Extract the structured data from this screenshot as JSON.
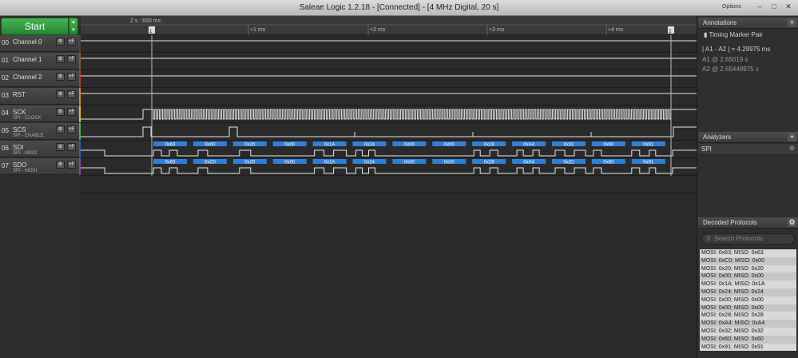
{
  "window": {
    "title": "Saleae Logic 1.2.18 - [Connected] - [4 MHz Digital, 20 s]",
    "options_label": "Options",
    "minimize_icon": "–",
    "maximize_icon": "□",
    "close_icon": "✕"
  },
  "controls": {
    "start_label": "Start",
    "arrow_up": "▲",
    "arrow_down": "▼"
  },
  "ruler": {
    "position_label": "2 s : 650 ms",
    "ticks": [
      "+1 ms",
      "+2 ms",
      "+3 ms",
      "+4 ms"
    ]
  },
  "channels": [
    {
      "num": "00",
      "name": "Channel 0",
      "sub": "",
      "color": "#444444"
    },
    {
      "num": "01",
      "name": "Channel 1",
      "sub": "",
      "color": "#8b5a2b"
    },
    {
      "num": "02",
      "name": "Channel 2",
      "sub": "",
      "color": "#c0392b"
    },
    {
      "num": "03",
      "name": "RST",
      "sub": "",
      "color": "#e08a1a"
    },
    {
      "num": "04",
      "name": "SCK",
      "sub": "SPI - CLOCK",
      "color": "#e8c11a"
    },
    {
      "num": "05",
      "name": "SCS",
      "sub": "SPI - ENABLE",
      "color": "#4caf50"
    },
    {
      "num": "06",
      "name": "SDI",
      "sub": "SPI - MISO",
      "color": "#2f5fc4"
    },
    {
      "num": "07",
      "name": "SDO",
      "sub": "SPI - MOSI",
      "color": "#8e44ad"
    }
  ],
  "channel_buttons": {
    "gear": "⚙",
    "flag": "+F"
  },
  "protocol_bytes": {
    "miso": [
      "0x63",
      "0x00",
      "0x20",
      "0x00",
      "0x1A",
      "0x24",
      "0x00",
      "0x00",
      "0x28",
      "0xA4",
      "0x32",
      "0x60",
      "0x91"
    ],
    "mosi": [
      "0x63",
      "0xC0",
      "0x20",
      "0x00",
      "0x1A",
      "0x24",
      "0x00",
      "0x00",
      "0x28",
      "0xA4",
      "0x32",
      "0x60",
      "0x91"
    ]
  },
  "accent": {
    "frame_blue": "#2f7fd6",
    "start_green": "#2ea043"
  },
  "annotations": {
    "title": "Annotations",
    "marker_pair": "Timing Marker Pair",
    "delta_label": "| A1 - A2 |",
    "delta_value": "= 4.29975 ms",
    "a1_label": "A1  @  2.65019 s",
    "a2_label": "A2  @  2.65448975 s"
  },
  "analyzers": {
    "title": "Analyzers",
    "items": [
      "SPI"
    ]
  },
  "decoded": {
    "title": "Decoded Protocols",
    "search_placeholder": "Search Protocols",
    "rows": [
      "MOSI: 0x63;  MISO: 0x63",
      "MOSI: 0xC0;  MISO: 0x00",
      "MOSI: 0x20;  MISO: 0x20",
      "MOSI: 0x00;  MISO: 0x00",
      "MOSI: 0x1A;  MISO: 0x1A",
      "MOSI: 0x24;  MISO: 0x24",
      "MOSI: 0x00;  MISO: 0x00",
      "MOSI: 0x00;  MISO: 0x00",
      "MOSI: 0x28;  MISO: 0x28",
      "MOSI: 0xA4;  MISO: 0xA4",
      "MOSI: 0x32;  MISO: 0x32",
      "MOSI: 0x60;  MISO: 0x60",
      "MOSI: 0x91;  MISO: 0x91"
    ]
  }
}
